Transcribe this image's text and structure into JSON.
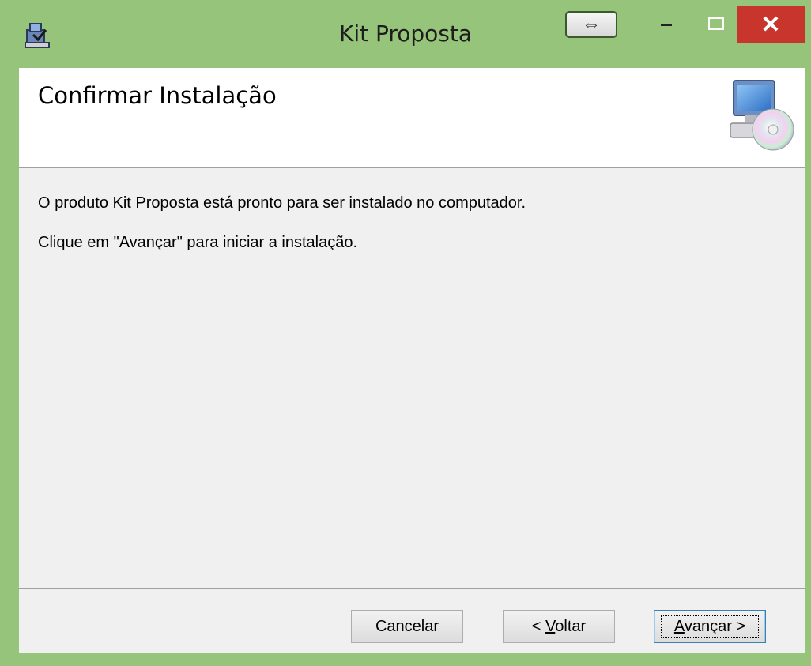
{
  "window": {
    "title": "Kit Proposta",
    "colors": {
      "frame": "#96c47a",
      "close": "#c7352c",
      "client": "#f0f0f0"
    }
  },
  "titlebar_buttons": {
    "resize_icon": "⇔",
    "close_icon": "✕"
  },
  "header": {
    "title": "Confirmar Instalação",
    "graphic_icon": "computer-cd-icon"
  },
  "body": {
    "line1": "O produto Kit Proposta está pronto para ser instalado no computador.",
    "line2": "Clique em \"Avançar\" para iniciar a instalação."
  },
  "buttons": {
    "cancel": "Cancelar",
    "back_prefix": "< ",
    "back_mnemonic": "V",
    "back_rest": "oltar",
    "next_mnemonic": "A",
    "next_rest": "vançar >"
  }
}
